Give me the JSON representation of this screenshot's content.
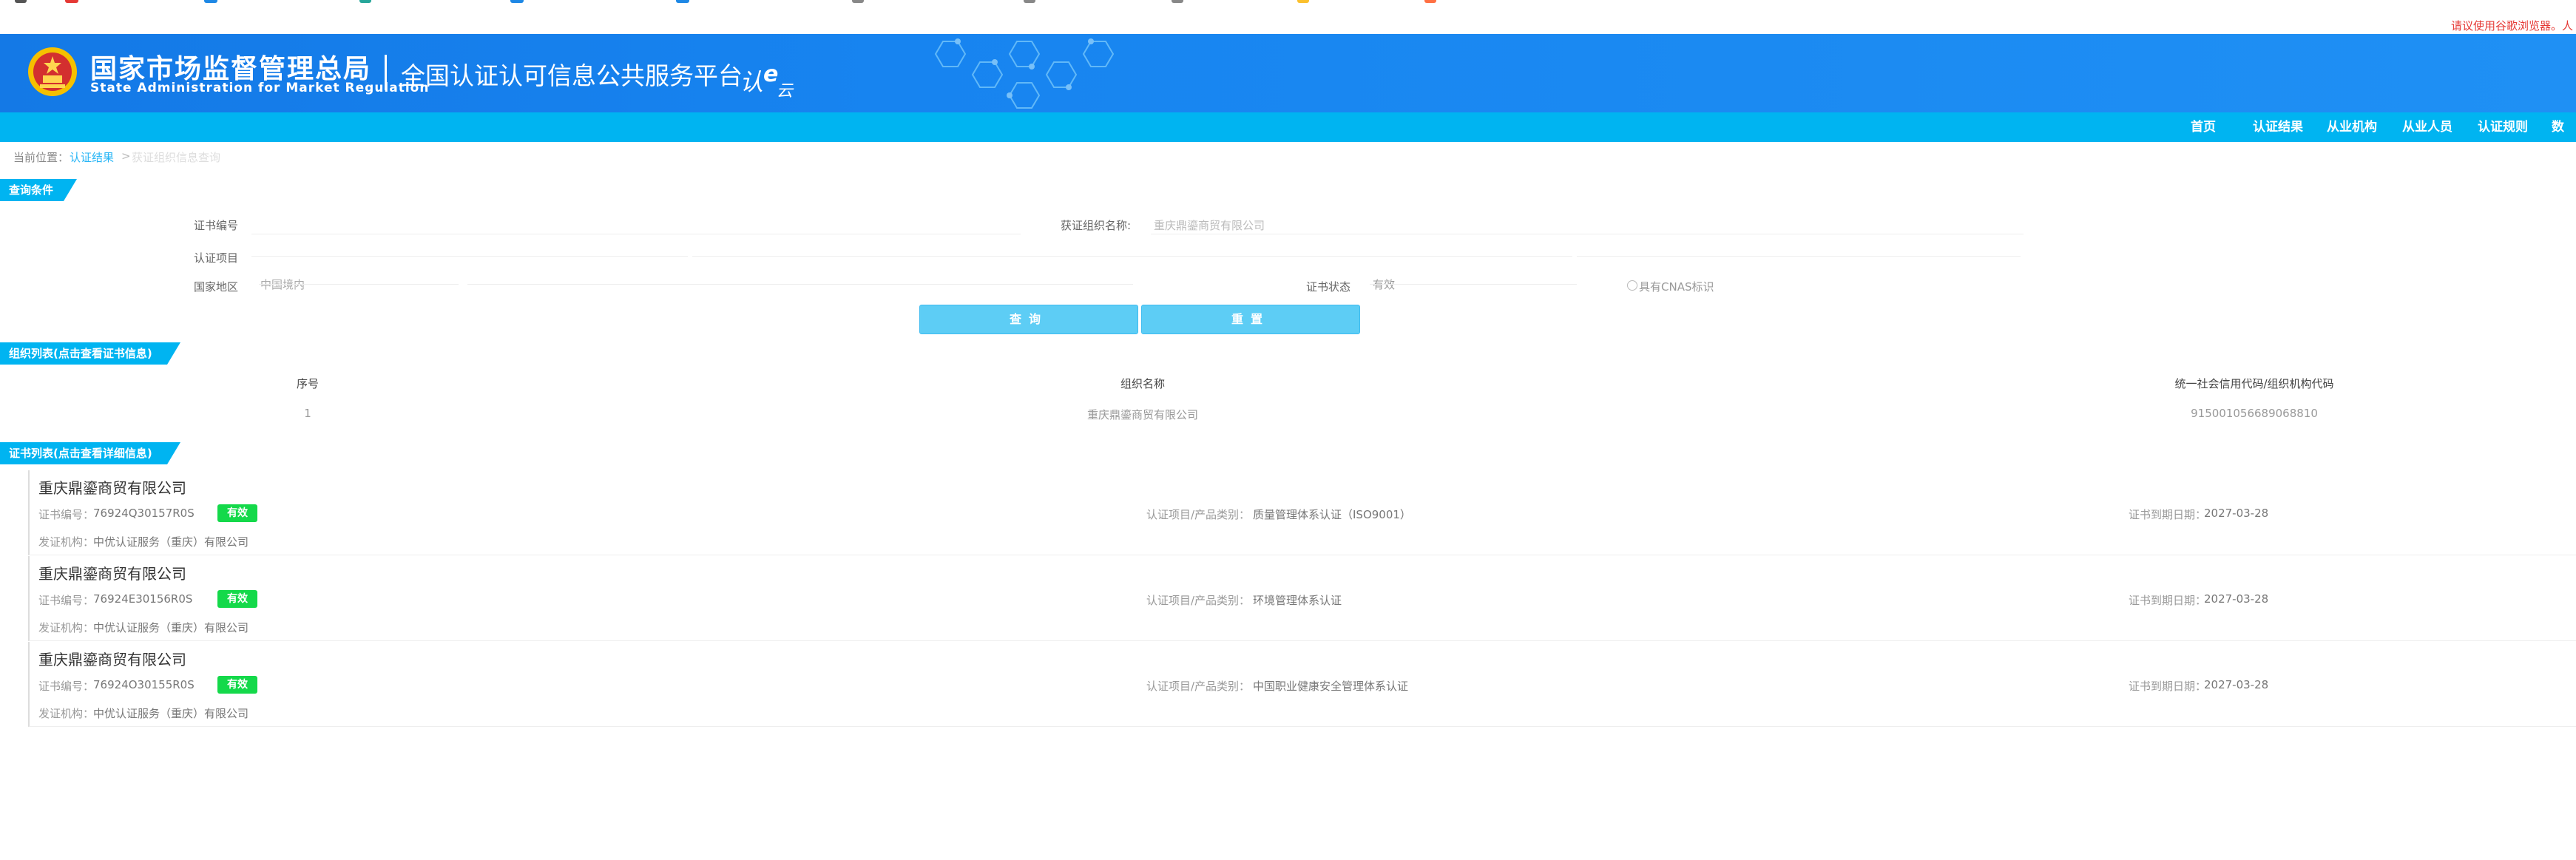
{
  "header": {
    "agency_cn": "国家市场监督管理总局",
    "agency_en": "State Administration  for  Market Regulation",
    "platform_title": "全国认证认可信息公共服务平台",
    "logo_text": "认e云",
    "tip": "请议使用谷歌浏览器。人"
  },
  "nav": {
    "items": [
      "首页",
      "认证结果",
      "从业机构",
      "从业人员",
      "认证规则",
      "数据"
    ]
  },
  "breadcrumb": {
    "prefix": "当前位置：",
    "link": "认证结果",
    "sep": ">",
    "current": "获证组织信息查询"
  },
  "query": {
    "tab_label": "查询条件",
    "cert_no_label": "证书编号",
    "org_name_label": "获证组织名称:",
    "org_name_value": "重庆鼎鎏商贸有限公司",
    "cert_item_label": "认证项目",
    "region_label": "国家地区",
    "region_value": "中国境内",
    "status_label": "证书状态",
    "status_value": "有效",
    "cnas_label": "具有CNAS标识",
    "search_button": "查询",
    "reset_button": "重置"
  },
  "org_list": {
    "tab_label": "组织列表(点击查看证书信息)",
    "columns": [
      "序号",
      "组织名称",
      "统一社会信用代码/组织机构代码"
    ],
    "rows": [
      [
        "1",
        "重庆鼎鎏商贸有限公司",
        "915001056689068810"
      ]
    ]
  },
  "cert_list": {
    "tab_label": "证书列表(点击查看详细信息)",
    "cert_no_prefix": "证书编号：",
    "item_prefix": "认证项目/产品类别：",
    "expiry_prefix": "证书到期日期：",
    "issuer_prefix": "发证机构：",
    "items": [
      {
        "org": "重庆鼎鎏商贸有限公司",
        "cert_no": "76924Q30157R0S",
        "status": "有效",
        "item": "质量管理体系认证（ISO9001）",
        "expiry": "2027-03-28",
        "issuer": "中优认证服务（重庆）有限公司"
      },
      {
        "org": "重庆鼎鎏商贸有限公司",
        "cert_no": "76924E30156R0S",
        "status": "有效",
        "item": "环境管理体系认证",
        "expiry": "2027-03-28",
        "issuer": "中优认证服务（重庆）有限公司"
      },
      {
        "org": "重庆鼎鎏商贸有限公司",
        "cert_no": "76924O30155R0S",
        "status": "有效",
        "item": "中国职业健康安全管理体系认证",
        "expiry": "2027-03-28",
        "issuer": "中优认证服务（重庆）有限公司"
      }
    ]
  },
  "colors": {
    "header_blue": "#1784f0",
    "nav_cyan": "#00b4f1",
    "button_cyan": "#5dcdf5",
    "status_green": "#14d94a",
    "tip_red": "#e53935",
    "link_cyan": "#29b6f6"
  }
}
